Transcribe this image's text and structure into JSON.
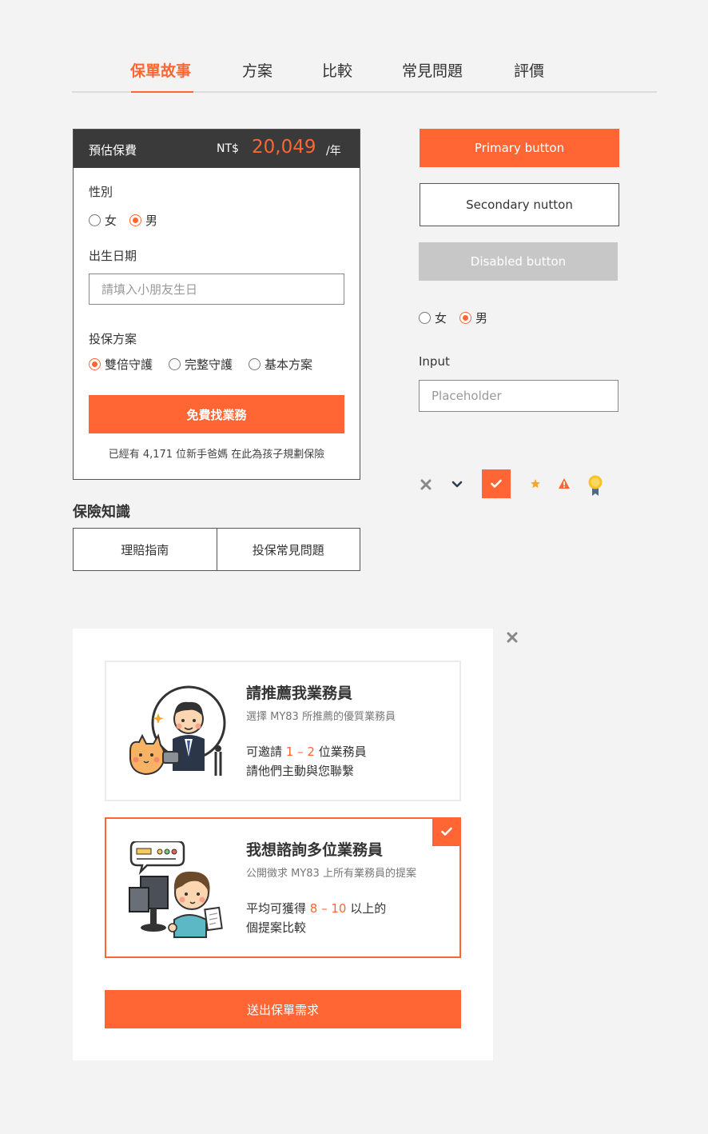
{
  "tabs": [
    "保單故事",
    "方案",
    "比較",
    "常見問題",
    "評價"
  ],
  "quote": {
    "header_label": "預估保費",
    "currency": "NT$",
    "price": "20,049",
    "unit": "/年",
    "gender_label": "性別",
    "gender_options": [
      "女",
      "男"
    ],
    "gender_selected": "男",
    "birth_label": "出生日期",
    "birth_placeholder": "請填入小朋友生日",
    "plan_label": "投保方案",
    "plan_options": [
      "雙倍守護",
      "完整守護",
      "基本方案"
    ],
    "plan_selected": "雙倍守護",
    "cta": "免費找業務",
    "note": "已經有 4,171 位新手爸媽 在此為孩子規劃保險"
  },
  "knowledge": {
    "title": "保險知識",
    "items": [
      "理賠指南",
      "投保常見問題"
    ]
  },
  "components": {
    "primary": "Primary button",
    "secondary": "Secondary nutton",
    "disabled": "Disabled button",
    "radio_options": [
      "女",
      "男"
    ],
    "radio_selected": "男",
    "input_label": "Input",
    "input_placeholder": "Placeholder",
    "icons": [
      "close-icon",
      "chevron-down-icon",
      "check-box-icon",
      "star-icon",
      "warning-icon",
      "medal-icon"
    ]
  },
  "modal": {
    "option1": {
      "title": "請推薦我業務員",
      "sub": "選擇 MY83 所推薦的優質業務員",
      "line1_pre": "可邀請 ",
      "line1_hl": "1 – 2",
      "line1_post": " 位業務員",
      "line2": "請他們主動與您聯繫"
    },
    "option2": {
      "title": "我想諮詢多位業務員",
      "sub": "公開徵求 MY83 上所有業務員的提案",
      "line1_pre": "平均可獲得 ",
      "line1_hl": "8 – 10",
      "line1_post": " 以上的",
      "line2": "個提案比較"
    },
    "submit": "送出保單需求",
    "selected": "option2"
  },
  "colors": {
    "accent": "#ff6633",
    "dark_header": "#3a3a3a",
    "disabled": "#c7c7c7",
    "background": "#f3f3f4"
  }
}
